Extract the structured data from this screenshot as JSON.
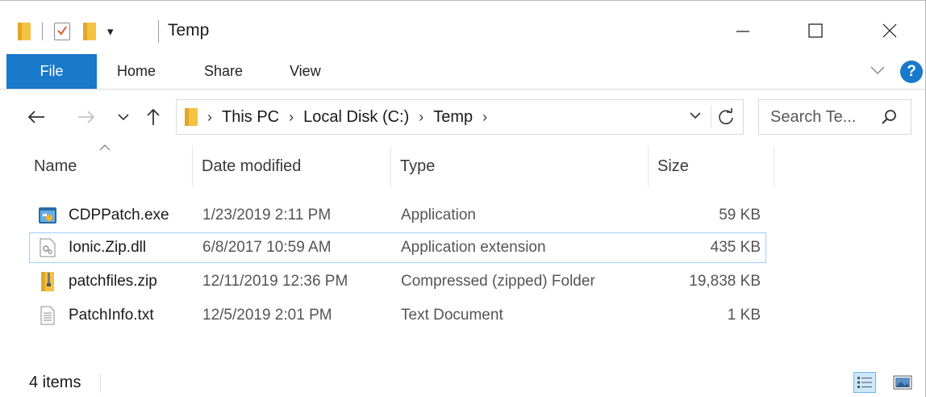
{
  "window": {
    "title": "Temp",
    "qat_dropdown_glyph": "▾"
  },
  "ribbon": {
    "tabs": [
      {
        "label": "File"
      },
      {
        "label": "Home"
      },
      {
        "label": "Share"
      },
      {
        "label": "View"
      }
    ],
    "help_glyph": "?",
    "accent_color": "#1979ca"
  },
  "address": {
    "breadcrumbs": [
      "This PC",
      "Local Disk (C:)",
      "Temp"
    ],
    "chevron": "›"
  },
  "search": {
    "placeholder": "Search Te..."
  },
  "columns": {
    "name": "Name",
    "date_modified": "Date modified",
    "type": "Type",
    "size": "Size"
  },
  "files": [
    {
      "name": "CDPPatch.exe",
      "date": "1/23/2019 2:11 PM",
      "type": "Application",
      "size": "59 KB",
      "icon": "exe-icon"
    },
    {
      "name": "Ionic.Zip.dll",
      "date": "6/8/2017 10:59 AM",
      "type": "Application extension",
      "size": "435 KB",
      "icon": "dll-icon",
      "selected": true
    },
    {
      "name": "patchfiles.zip",
      "date": "12/11/2019 12:36 PM",
      "type": "Compressed (zipped) Folder",
      "size": "19,838 KB",
      "icon": "zip-folder-icon"
    },
    {
      "name": "PatchInfo.txt",
      "date": "12/5/2019 2:01 PM",
      "type": "Text Document",
      "size": "1 KB",
      "icon": "text-document-icon"
    }
  ],
  "status": {
    "item_count": "4 items"
  }
}
